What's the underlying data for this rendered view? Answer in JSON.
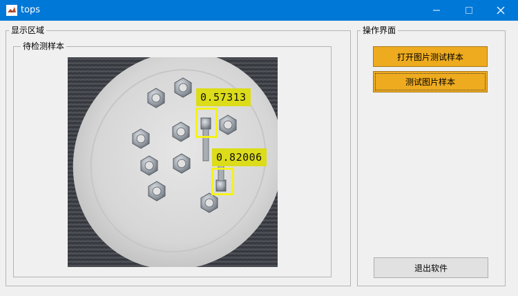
{
  "window": {
    "title": "tops"
  },
  "titlebar_buttons": {
    "minimize": "—",
    "maximize": "☐",
    "close": "✕"
  },
  "display_panel": {
    "title": "显示区域"
  },
  "sample_panel": {
    "title": "待检测样本"
  },
  "ops_panel": {
    "title": "操作界面",
    "open_button": "打开图片测试样本",
    "test_button": "测试图片样本",
    "exit_button": "退出软件"
  },
  "detections": [
    {
      "score": "0.57313"
    },
    {
      "score": "0.82006"
    }
  ],
  "colors": {
    "titlebar": "#0078d7",
    "button_orange": "#eeab1f",
    "detection_yellow": "#f4f21a",
    "label_yellow": "#dcdc1a"
  }
}
